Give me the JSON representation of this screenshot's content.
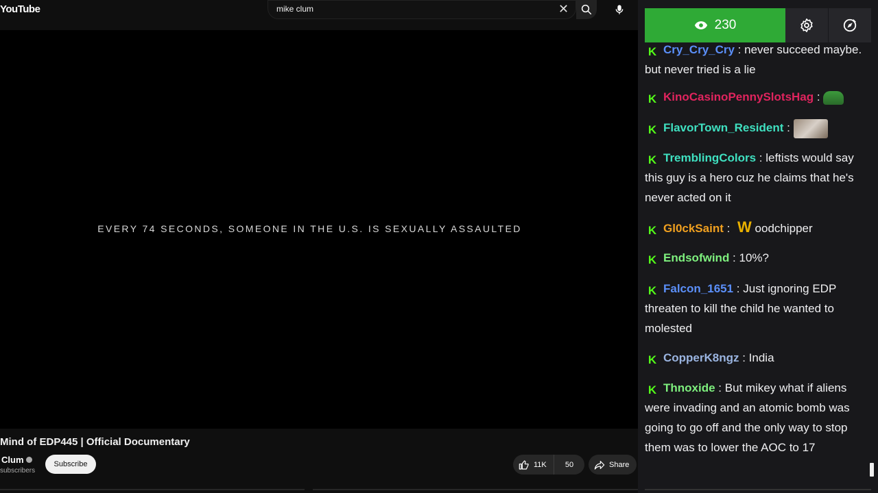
{
  "youtube": {
    "logo": "YouTube",
    "search": {
      "value": "mike clum"
    },
    "player": {
      "overlay_text": "EVERY 74 SECONDS, SOMEONE IN THE U.S. IS SEXUALLY ASSAULTED"
    },
    "video": {
      "title": "Mind of EDP445 | Official Documentary",
      "channel": "Clum",
      "subscribers": "subscribers",
      "subscribe_label": "Subscribe",
      "likes": "11K",
      "dislikes": "50",
      "share_label": "Share"
    }
  },
  "chat": {
    "viewer_count": "230",
    "messages": [
      {
        "user": "Cry_Cry_Cry",
        "user_color": "#5b8ff9",
        "text": "never succeed maybe. but never tried is a lie"
      },
      {
        "user": "KinoCasinoPennySlotsHag",
        "user_color": "#e0245e",
        "text": "",
        "emote": "frog-emote"
      },
      {
        "user": "FlavorTown_Resident",
        "user_color": "#3fe0c0",
        "text": "",
        "emote": "photo-emote"
      },
      {
        "user": "TremblingColors",
        "user_color": "#3fe0c0",
        "text": "leftists would say this guy is a hero cuz he claims that he's never acted on it"
      },
      {
        "user": "Gl0ckSaint",
        "user_color": "#f0a020",
        "text": "oodchipper",
        "emote_text": "W"
      },
      {
        "user": "Endsofwind",
        "user_color": "#7ef07e",
        "text": "10%?"
      },
      {
        "user": "Falcon_1651",
        "user_color": "#5b8ff9",
        "text": "Just ignoring EDP threaten to kill the child he wanted to molested"
      },
      {
        "user": "CopperK8ngz",
        "user_color": "#9ab4e0",
        "text": "India"
      },
      {
        "user": "Thnoxide",
        "user_color": "#7ef07e",
        "text": "But mikey what if aliens were invading and an atomic bomb was going to go off and the only way to stop them was to lower the AOC to 17"
      }
    ]
  }
}
